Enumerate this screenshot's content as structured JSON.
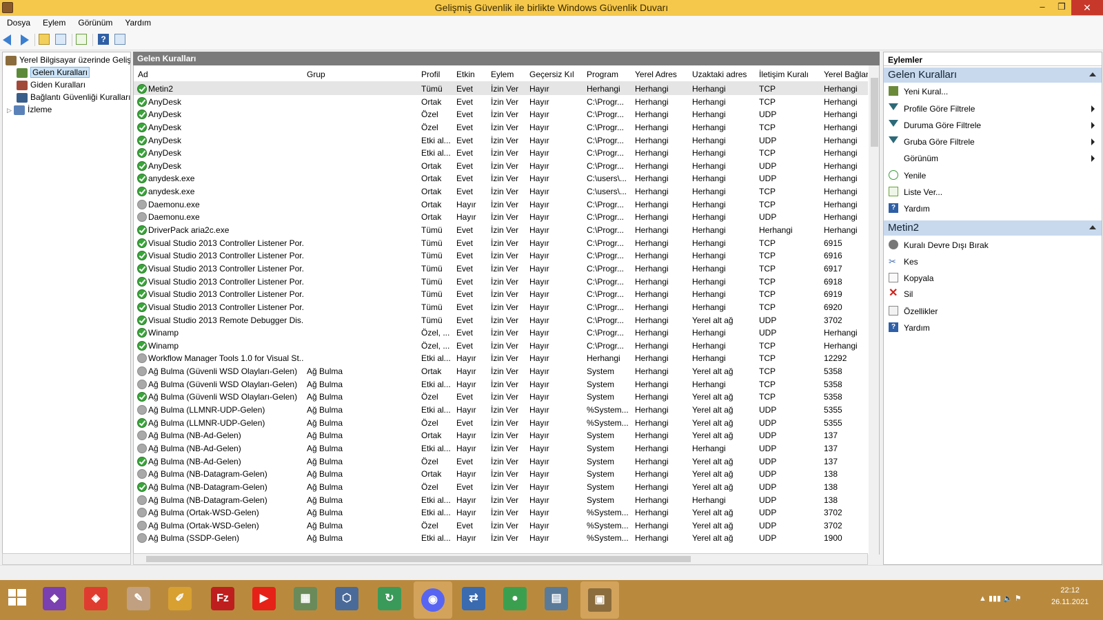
{
  "window": {
    "title": "Gelişmiş Güvenlik ile birlikte Windows Güvenlik Duvarı",
    "min_glyph": "–",
    "max_glyph": "❐",
    "close_glyph": "✕"
  },
  "menu": [
    "Dosya",
    "Eylem",
    "Görünüm",
    "Yardım"
  ],
  "tree": {
    "root": "Yerel Bilgisayar üzerinde Gelişmiş",
    "items": [
      "Gelen Kuralları",
      "Giden Kuralları",
      "Bağlantı Güvenliği Kuralları",
      "İzleme"
    ],
    "expand_glyph": "▷"
  },
  "center": {
    "header": "Gelen Kuralları",
    "columns": [
      "Ad",
      "Grup",
      "Profil",
      "Etkin",
      "Eylem",
      "Geçersiz Kıl",
      "Program",
      "Yerel Adres",
      "Uzaktaki adres",
      "İletişim Kuralı",
      "Yerel Bağlan"
    ],
    "rows": [
      {
        "s": "on",
        "ad": "Metin2",
        "grup": "",
        "profil": "Tümü",
        "etkin": "Evet",
        "eylem": "İzin Ver",
        "gecersiz": "Hayır",
        "program": "Herhangi",
        "yerel": "Herhangi",
        "uzak": "Herhangi",
        "iletisim": "TCP",
        "port": "Herhangi"
      },
      {
        "s": "on",
        "ad": "AnyDesk",
        "grup": "",
        "profil": "Ortak",
        "etkin": "Evet",
        "eylem": "İzin Ver",
        "gecersiz": "Hayır",
        "program": "C:\\Progr...",
        "yerel": "Herhangi",
        "uzak": "Herhangi",
        "iletisim": "TCP",
        "port": "Herhangi"
      },
      {
        "s": "on",
        "ad": "AnyDesk",
        "grup": "",
        "profil": "Özel",
        "etkin": "Evet",
        "eylem": "İzin Ver",
        "gecersiz": "Hayır",
        "program": "C:\\Progr...",
        "yerel": "Herhangi",
        "uzak": "Herhangi",
        "iletisim": "UDP",
        "port": "Herhangi"
      },
      {
        "s": "on",
        "ad": "AnyDesk",
        "grup": "",
        "profil": "Özel",
        "etkin": "Evet",
        "eylem": "İzin Ver",
        "gecersiz": "Hayır",
        "program": "C:\\Progr...",
        "yerel": "Herhangi",
        "uzak": "Herhangi",
        "iletisim": "TCP",
        "port": "Herhangi"
      },
      {
        "s": "on",
        "ad": "AnyDesk",
        "grup": "",
        "profil": "Etki al...",
        "etkin": "Evet",
        "eylem": "İzin Ver",
        "gecersiz": "Hayır",
        "program": "C:\\Progr...",
        "yerel": "Herhangi",
        "uzak": "Herhangi",
        "iletisim": "UDP",
        "port": "Herhangi"
      },
      {
        "s": "on",
        "ad": "AnyDesk",
        "grup": "",
        "profil": "Etki al...",
        "etkin": "Evet",
        "eylem": "İzin Ver",
        "gecersiz": "Hayır",
        "program": "C:\\Progr...",
        "yerel": "Herhangi",
        "uzak": "Herhangi",
        "iletisim": "TCP",
        "port": "Herhangi"
      },
      {
        "s": "on",
        "ad": "AnyDesk",
        "grup": "",
        "profil": "Ortak",
        "etkin": "Evet",
        "eylem": "İzin Ver",
        "gecersiz": "Hayır",
        "program": "C:\\Progr...",
        "yerel": "Herhangi",
        "uzak": "Herhangi",
        "iletisim": "UDP",
        "port": "Herhangi"
      },
      {
        "s": "on",
        "ad": "anydesk.exe",
        "grup": "",
        "profil": "Ortak",
        "etkin": "Evet",
        "eylem": "İzin Ver",
        "gecersiz": "Hayır",
        "program": "C:\\users\\...",
        "yerel": "Herhangi",
        "uzak": "Herhangi",
        "iletisim": "UDP",
        "port": "Herhangi"
      },
      {
        "s": "on",
        "ad": "anydesk.exe",
        "grup": "",
        "profil": "Ortak",
        "etkin": "Evet",
        "eylem": "İzin Ver",
        "gecersiz": "Hayır",
        "program": "C:\\users\\...",
        "yerel": "Herhangi",
        "uzak": "Herhangi",
        "iletisim": "TCP",
        "port": "Herhangi"
      },
      {
        "s": "off",
        "ad": "Daemonu.exe",
        "grup": "",
        "profil": "Ortak",
        "etkin": "Hayır",
        "eylem": "İzin Ver",
        "gecersiz": "Hayır",
        "program": "C:\\Progr...",
        "yerel": "Herhangi",
        "uzak": "Herhangi",
        "iletisim": "TCP",
        "port": "Herhangi"
      },
      {
        "s": "off",
        "ad": "Daemonu.exe",
        "grup": "",
        "profil": "Ortak",
        "etkin": "Hayır",
        "eylem": "İzin Ver",
        "gecersiz": "Hayır",
        "program": "C:\\Progr...",
        "yerel": "Herhangi",
        "uzak": "Herhangi",
        "iletisim": "UDP",
        "port": "Herhangi"
      },
      {
        "s": "on",
        "ad": "DriverPack aria2c.exe",
        "grup": "",
        "profil": "Tümü",
        "etkin": "Evet",
        "eylem": "İzin Ver",
        "gecersiz": "Hayır",
        "program": "C:\\Progr...",
        "yerel": "Herhangi",
        "uzak": "Herhangi",
        "iletisim": "Herhangi",
        "port": "Herhangi"
      },
      {
        "s": "on",
        "ad": "Visual Studio 2013 Controller Listener Por...",
        "grup": "",
        "profil": "Tümü",
        "etkin": "Evet",
        "eylem": "İzin Ver",
        "gecersiz": "Hayır",
        "program": "C:\\Progr...",
        "yerel": "Herhangi",
        "uzak": "Herhangi",
        "iletisim": "TCP",
        "port": "6915"
      },
      {
        "s": "on",
        "ad": "Visual Studio 2013 Controller Listener Por...",
        "grup": "",
        "profil": "Tümü",
        "etkin": "Evet",
        "eylem": "İzin Ver",
        "gecersiz": "Hayır",
        "program": "C:\\Progr...",
        "yerel": "Herhangi",
        "uzak": "Herhangi",
        "iletisim": "TCP",
        "port": "6916"
      },
      {
        "s": "on",
        "ad": "Visual Studio 2013 Controller Listener Por...",
        "grup": "",
        "profil": "Tümü",
        "etkin": "Evet",
        "eylem": "İzin Ver",
        "gecersiz": "Hayır",
        "program": "C:\\Progr...",
        "yerel": "Herhangi",
        "uzak": "Herhangi",
        "iletisim": "TCP",
        "port": "6917"
      },
      {
        "s": "on",
        "ad": "Visual Studio 2013 Controller Listener Por...",
        "grup": "",
        "profil": "Tümü",
        "etkin": "Evet",
        "eylem": "İzin Ver",
        "gecersiz": "Hayır",
        "program": "C:\\Progr...",
        "yerel": "Herhangi",
        "uzak": "Herhangi",
        "iletisim": "TCP",
        "port": "6918"
      },
      {
        "s": "on",
        "ad": "Visual Studio 2013 Controller Listener Por...",
        "grup": "",
        "profil": "Tümü",
        "etkin": "Evet",
        "eylem": "İzin Ver",
        "gecersiz": "Hayır",
        "program": "C:\\Progr...",
        "yerel": "Herhangi",
        "uzak": "Herhangi",
        "iletisim": "TCP",
        "port": "6919"
      },
      {
        "s": "on",
        "ad": "Visual Studio 2013 Controller Listener Por...",
        "grup": "",
        "profil": "Tümü",
        "etkin": "Evet",
        "eylem": "İzin Ver",
        "gecersiz": "Hayır",
        "program": "C:\\Progr...",
        "yerel": "Herhangi",
        "uzak": "Herhangi",
        "iletisim": "TCP",
        "port": "6920"
      },
      {
        "s": "on",
        "ad": "Visual Studio 2013 Remote Debugger Dis...",
        "grup": "",
        "profil": "Tümü",
        "etkin": "Evet",
        "eylem": "İzin Ver",
        "gecersiz": "Hayır",
        "program": "C:\\Progr...",
        "yerel": "Herhangi",
        "uzak": "Yerel alt ağ",
        "iletisim": "UDP",
        "port": "3702"
      },
      {
        "s": "on",
        "ad": "Winamp",
        "grup": "",
        "profil": "Özel, ...",
        "etkin": "Evet",
        "eylem": "İzin Ver",
        "gecersiz": "Hayır",
        "program": "C:\\Progr...",
        "yerel": "Herhangi",
        "uzak": "Herhangi",
        "iletisim": "UDP",
        "port": "Herhangi"
      },
      {
        "s": "on",
        "ad": "Winamp",
        "grup": "",
        "profil": "Özel, ...",
        "etkin": "Evet",
        "eylem": "İzin Ver",
        "gecersiz": "Hayır",
        "program": "C:\\Progr...",
        "yerel": "Herhangi",
        "uzak": "Herhangi",
        "iletisim": "TCP",
        "port": "Herhangi"
      },
      {
        "s": "off",
        "ad": "Workflow Manager Tools 1.0 for Visual St...",
        "grup": "",
        "profil": "Etki al...",
        "etkin": "Hayır",
        "eylem": "İzin Ver",
        "gecersiz": "Hayır",
        "program": "Herhangi",
        "yerel": "Herhangi",
        "uzak": "Herhangi",
        "iletisim": "TCP",
        "port": "12292"
      },
      {
        "s": "off",
        "ad": "Ağ Bulma (Güvenli WSD Olayları-Gelen)",
        "grup": "Ağ Bulma",
        "profil": "Ortak",
        "etkin": "Hayır",
        "eylem": "İzin Ver",
        "gecersiz": "Hayır",
        "program": "System",
        "yerel": "Herhangi",
        "uzak": "Yerel alt ağ",
        "iletisim": "TCP",
        "port": "5358"
      },
      {
        "s": "off",
        "ad": "Ağ Bulma (Güvenli WSD Olayları-Gelen)",
        "grup": "Ağ Bulma",
        "profil": "Etki al...",
        "etkin": "Hayır",
        "eylem": "İzin Ver",
        "gecersiz": "Hayır",
        "program": "System",
        "yerel": "Herhangi",
        "uzak": "Herhangi",
        "iletisim": "TCP",
        "port": "5358"
      },
      {
        "s": "on",
        "ad": "Ağ Bulma (Güvenli WSD Olayları-Gelen)",
        "grup": "Ağ Bulma",
        "profil": "Özel",
        "etkin": "Evet",
        "eylem": "İzin Ver",
        "gecersiz": "Hayır",
        "program": "System",
        "yerel": "Herhangi",
        "uzak": "Yerel alt ağ",
        "iletisim": "TCP",
        "port": "5358"
      },
      {
        "s": "off",
        "ad": "Ağ Bulma (LLMNR-UDP-Gelen)",
        "grup": "Ağ Bulma",
        "profil": "Etki al...",
        "etkin": "Hayır",
        "eylem": "İzin Ver",
        "gecersiz": "Hayır",
        "program": "%System...",
        "yerel": "Herhangi",
        "uzak": "Yerel alt ağ",
        "iletisim": "UDP",
        "port": "5355"
      },
      {
        "s": "on",
        "ad": "Ağ Bulma (LLMNR-UDP-Gelen)",
        "grup": "Ağ Bulma",
        "profil": "Özel",
        "etkin": "Evet",
        "eylem": "İzin Ver",
        "gecersiz": "Hayır",
        "program": "%System...",
        "yerel": "Herhangi",
        "uzak": "Yerel alt ağ",
        "iletisim": "UDP",
        "port": "5355"
      },
      {
        "s": "off",
        "ad": "Ağ Bulma (NB-Ad-Gelen)",
        "grup": "Ağ Bulma",
        "profil": "Ortak",
        "etkin": "Hayır",
        "eylem": "İzin Ver",
        "gecersiz": "Hayır",
        "program": "System",
        "yerel": "Herhangi",
        "uzak": "Yerel alt ağ",
        "iletisim": "UDP",
        "port": "137"
      },
      {
        "s": "off",
        "ad": "Ağ Bulma (NB-Ad-Gelen)",
        "grup": "Ağ Bulma",
        "profil": "Etki al...",
        "etkin": "Hayır",
        "eylem": "İzin Ver",
        "gecersiz": "Hayır",
        "program": "System",
        "yerel": "Herhangi",
        "uzak": "Herhangi",
        "iletisim": "UDP",
        "port": "137"
      },
      {
        "s": "on",
        "ad": "Ağ Bulma (NB-Ad-Gelen)",
        "grup": "Ağ Bulma",
        "profil": "Özel",
        "etkin": "Evet",
        "eylem": "İzin Ver",
        "gecersiz": "Hayır",
        "program": "System",
        "yerel": "Herhangi",
        "uzak": "Yerel alt ağ",
        "iletisim": "UDP",
        "port": "137"
      },
      {
        "s": "off",
        "ad": "Ağ Bulma (NB-Datagram-Gelen)",
        "grup": "Ağ Bulma",
        "profil": "Ortak",
        "etkin": "Hayır",
        "eylem": "İzin Ver",
        "gecersiz": "Hayır",
        "program": "System",
        "yerel": "Herhangi",
        "uzak": "Yerel alt ağ",
        "iletisim": "UDP",
        "port": "138"
      },
      {
        "s": "on",
        "ad": "Ağ Bulma (NB-Datagram-Gelen)",
        "grup": "Ağ Bulma",
        "profil": "Özel",
        "etkin": "Evet",
        "eylem": "İzin Ver",
        "gecersiz": "Hayır",
        "program": "System",
        "yerel": "Herhangi",
        "uzak": "Yerel alt ağ",
        "iletisim": "UDP",
        "port": "138"
      },
      {
        "s": "off",
        "ad": "Ağ Bulma (NB-Datagram-Gelen)",
        "grup": "Ağ Bulma",
        "profil": "Etki al...",
        "etkin": "Hayır",
        "eylem": "İzin Ver",
        "gecersiz": "Hayır",
        "program": "System",
        "yerel": "Herhangi",
        "uzak": "Herhangi",
        "iletisim": "UDP",
        "port": "138"
      },
      {
        "s": "off",
        "ad": "Ağ Bulma (Ortak-WSD-Gelen)",
        "grup": "Ağ Bulma",
        "profil": "Etki al...",
        "etkin": "Hayır",
        "eylem": "İzin Ver",
        "gecersiz": "Hayır",
        "program": "%System...",
        "yerel": "Herhangi",
        "uzak": "Yerel alt ağ",
        "iletisim": "UDP",
        "port": "3702"
      },
      {
        "s": "off",
        "ad": "Ağ Bulma (Ortak-WSD-Gelen)",
        "grup": "Ağ Bulma",
        "profil": "Özel",
        "etkin": "Evet",
        "eylem": "İzin Ver",
        "gecersiz": "Hayır",
        "program": "%System...",
        "yerel": "Herhangi",
        "uzak": "Yerel alt ağ",
        "iletisim": "UDP",
        "port": "3702"
      },
      {
        "s": "off",
        "ad": "Ağ Bulma (SSDP-Gelen)",
        "grup": "Ağ Bulma",
        "profil": "Etki al...",
        "etkin": "Hayır",
        "eylem": "İzin Ver",
        "gecersiz": "Hayır",
        "program": "%System...",
        "yerel": "Herhangi",
        "uzak": "Yerel alt ağ",
        "iletisim": "UDP",
        "port": "1900"
      }
    ]
  },
  "actions": {
    "header": "Eylemler",
    "section1": {
      "title": "Gelen Kuralları",
      "items": [
        "Yeni Kural...",
        "Profile Göre Filtrele",
        "Duruma Göre Filtrele",
        "Gruba Göre Filtrele",
        "Görünüm",
        "Yenile",
        "Liste Ver...",
        "Yardım"
      ]
    },
    "section2": {
      "title": "Metin2",
      "items": [
        "Kuralı Devre Dışı Bırak",
        "Kes",
        "Kopyala",
        "Sil",
        "Özellikler",
        "Yardım"
      ]
    }
  },
  "taskbar": {
    "apps": [
      "Windows",
      "Visual Studio",
      "App",
      "App",
      "App",
      "FileZilla",
      "YouTube",
      "App",
      "App",
      "App",
      "Discord",
      "App",
      "Chrome",
      "App",
      "Firewall"
    ],
    "time": "22:12",
    "date": "26.11.2021"
  },
  "colors": {
    "titlebar": "#f5c84c",
    "taskbar": "#b98a3e",
    "enabled": "#3aa53a",
    "disabled": "#a9a9a9",
    "section": "#c8d9ee"
  }
}
